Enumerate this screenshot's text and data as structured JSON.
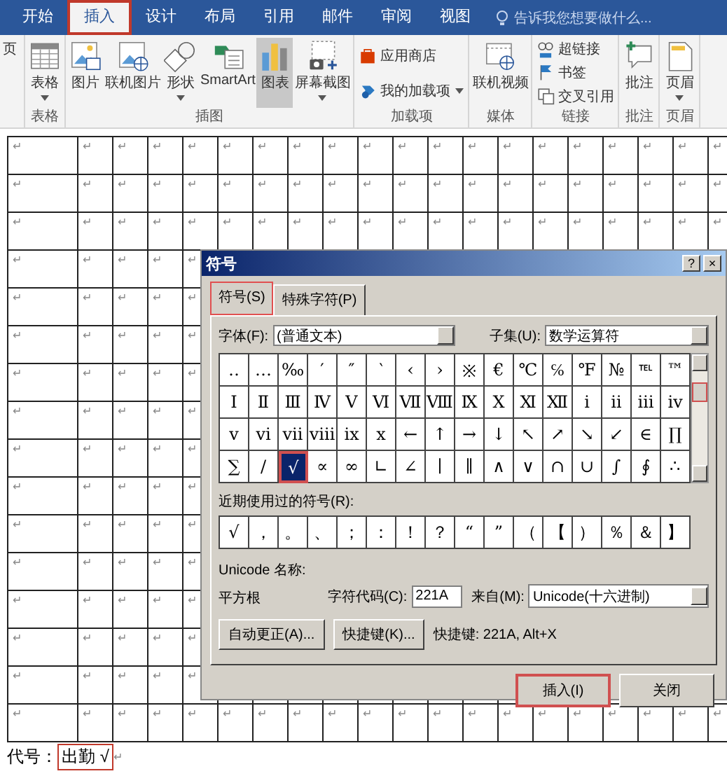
{
  "ribbon": {
    "tabs": [
      {
        "label": "开始",
        "selected": false,
        "highlighted": false
      },
      {
        "label": "插入",
        "selected": true,
        "highlighted": true
      },
      {
        "label": "设计",
        "selected": false,
        "highlighted": false
      },
      {
        "label": "布局",
        "selected": false,
        "highlighted": false
      },
      {
        "label": "引用",
        "selected": false,
        "highlighted": false
      },
      {
        "label": "邮件",
        "selected": false,
        "highlighted": false
      },
      {
        "label": "审阅",
        "selected": false,
        "highlighted": false
      },
      {
        "label": "视图",
        "selected": false,
        "highlighted": false
      }
    ],
    "tell_me": "告诉我您想要做什么...",
    "groups": [
      {
        "items": [
          {
            "label": "页",
            "kind": "large",
            "dropdown": false,
            "hovered": false
          }
        ]
      },
      {
        "label": "表格",
        "items": [
          {
            "label": "表格",
            "kind": "large",
            "dropdown": true,
            "hovered": false
          }
        ]
      },
      {
        "label": "插图",
        "items": [
          {
            "label": "图片",
            "kind": "large",
            "dropdown": false,
            "hovered": false
          },
          {
            "label": "联机图片",
            "kind": "large",
            "dropdown": false,
            "hovered": false
          },
          {
            "label": "形状",
            "kind": "large",
            "dropdown": true,
            "hovered": false
          },
          {
            "label": "SmartArt",
            "kind": "large",
            "dropdown": false,
            "hovered": false
          },
          {
            "label": "图表",
            "kind": "large",
            "dropdown": false,
            "hovered": true
          },
          {
            "label": "屏幕截图",
            "kind": "large",
            "dropdown": true,
            "hovered": false
          }
        ]
      },
      {
        "label": "加载项",
        "items": [
          {
            "label": "应用商店",
            "kind": "small",
            "dropdown": false,
            "hovered": false
          },
          {
            "label": "我的加载项",
            "kind": "small",
            "dropdown": true,
            "hovered": false
          }
        ]
      },
      {
        "label": "媒体",
        "items": [
          {
            "label": "联机视频",
            "kind": "large",
            "dropdown": false,
            "hovered": false
          }
        ]
      },
      {
        "label": "链接",
        "items": [
          {
            "label": "超链接",
            "kind": "small",
            "dropdown": false,
            "hovered": false
          },
          {
            "label": "书签",
            "kind": "small",
            "dropdown": false,
            "hovered": false
          },
          {
            "label": "交叉引用",
            "kind": "small",
            "dropdown": false,
            "hovered": false
          }
        ]
      },
      {
        "label": "批注",
        "items": [
          {
            "label": "批注",
            "kind": "large",
            "dropdown": false,
            "hovered": false
          }
        ]
      },
      {
        "label": "页眉",
        "items": [
          {
            "label": "页眉",
            "kind": "large",
            "dropdown": true,
            "hovered": false
          }
        ]
      }
    ]
  },
  "table": {
    "rows": [
      {
        "cells": [
          "↵",
          "↵",
          "↵",
          "↵",
          "↵",
          "↵",
          "↵",
          "↵",
          "↵",
          "↵",
          "↵",
          "↵",
          "↵",
          "↵",
          "↵",
          "↵",
          "↵",
          "↵",
          "↵",
          "↵"
        ]
      },
      {
        "cells": [
          "↵",
          "↵",
          "↵",
          "↵",
          "↵",
          "↵",
          "↵",
          "↵",
          "↵",
          "↵",
          "↵",
          "↵",
          "↵",
          "↵",
          "↵",
          "↵",
          "↵",
          "↵",
          "↵",
          "↵"
        ]
      },
      {
        "cells": [
          "↵",
          "↵",
          "↵",
          "↵",
          "↵",
          "↵",
          "↵",
          "↵",
          "↵",
          "↵",
          "↵",
          "↵",
          "↵",
          "↵",
          "↵",
          "↵",
          "↵",
          "↵",
          "↵",
          "↵"
        ]
      },
      {
        "cells": [
          "↵",
          "↵",
          "↵",
          "↵",
          "↵"
        ]
      },
      {
        "cells": [
          "↵",
          "↵",
          "↵",
          "↵",
          "↵"
        ]
      },
      {
        "cells": [
          "↵",
          "↵",
          "↵",
          "↵",
          "↵"
        ]
      },
      {
        "cells": [
          "↵",
          "↵",
          "↵",
          "↵",
          "↵"
        ]
      },
      {
        "cells": [
          "↵",
          "↵",
          "↵",
          "↵",
          "↵"
        ]
      },
      {
        "cells": [
          "↵",
          "↵",
          "↵",
          "↵",
          "↵"
        ]
      },
      {
        "cells": [
          "↵",
          "↵",
          "↵",
          "↵",
          "↵"
        ]
      },
      {
        "cells": [
          "↵",
          "↵",
          "↵",
          "↵",
          "↵"
        ]
      },
      {
        "cells": [
          "↵",
          "↵",
          "↵",
          "↵",
          "↵"
        ]
      },
      {
        "cells": [
          "↵",
          "↵",
          "↵",
          "↵",
          "↵"
        ]
      },
      {
        "cells": [
          "↵",
          "↵",
          "↵",
          "↵",
          "↵"
        ]
      },
      {
        "cells": [
          "↵",
          "↵",
          "↵",
          "↵",
          "↵"
        ]
      },
      {
        "cells": [
          "↵",
          "↵",
          "↵",
          "↵",
          "↵",
          "↵",
          "↵",
          "↵",
          "↵",
          "↵",
          "↵",
          "↵",
          "↵",
          "↵",
          "↵",
          "↵",
          "↵",
          "↵",
          "↵",
          "↵"
        ]
      }
    ]
  },
  "footer": {
    "label": "代号：",
    "value": "出勤 √",
    "highlighted": true,
    "mark": "↵"
  },
  "dialog": {
    "title": "符号",
    "help": "?",
    "close": "×",
    "tabs": [
      {
        "label": "符号(S)",
        "selected": true,
        "highlighted": true
      },
      {
        "label": "特殊字符(P)",
        "selected": false,
        "highlighted": false
      }
    ],
    "font_label": "字体(F):",
    "font_value": "(普通文本)",
    "subset_label": "子集(U):",
    "subset_value": "数学运算符",
    "symbols": [
      {
        "char": "‥",
        "selected": false
      },
      {
        "char": "…",
        "selected": false
      },
      {
        "char": "‰",
        "selected": false
      },
      {
        "char": "′",
        "selected": false
      },
      {
        "char": "″",
        "selected": false
      },
      {
        "char": "‵",
        "selected": false
      },
      {
        "char": "‹",
        "selected": false
      },
      {
        "char": "›",
        "selected": false
      },
      {
        "char": "※",
        "selected": false
      },
      {
        "char": "€",
        "selected": false
      },
      {
        "char": "℃",
        "selected": false
      },
      {
        "char": "℅",
        "selected": false
      },
      {
        "char": "℉",
        "selected": false
      },
      {
        "char": "№",
        "selected": false
      },
      {
        "char": "℡",
        "selected": false
      },
      {
        "char": "™",
        "selected": false
      },
      {
        "char": "Ⅰ",
        "selected": false
      },
      {
        "char": "Ⅱ",
        "selected": false
      },
      {
        "char": "Ⅲ",
        "selected": false
      },
      {
        "char": "Ⅳ",
        "selected": false
      },
      {
        "char": "Ⅴ",
        "selected": false
      },
      {
        "char": "Ⅵ",
        "selected": false
      },
      {
        "char": "Ⅶ",
        "selected": false
      },
      {
        "char": "Ⅷ",
        "selected": false
      },
      {
        "char": "Ⅸ",
        "selected": false
      },
      {
        "char": "Ⅹ",
        "selected": false
      },
      {
        "char": "Ⅺ",
        "selected": false
      },
      {
        "char": "Ⅻ",
        "selected": false
      },
      {
        "char": "ⅰ",
        "selected": false
      },
      {
        "char": "ⅱ",
        "selected": false
      },
      {
        "char": "ⅲ",
        "selected": false
      },
      {
        "char": "ⅳ",
        "selected": false
      },
      {
        "char": "ⅴ",
        "selected": false
      },
      {
        "char": "ⅵ",
        "selected": false
      },
      {
        "char": "ⅶ",
        "selected": false
      },
      {
        "char": "ⅷ",
        "selected": false
      },
      {
        "char": "ⅸ",
        "selected": false
      },
      {
        "char": "ⅹ",
        "selected": false
      },
      {
        "char": "←",
        "selected": false
      },
      {
        "char": "↑",
        "selected": false
      },
      {
        "char": "→",
        "selected": false
      },
      {
        "char": "↓",
        "selected": false
      },
      {
        "char": "↖",
        "selected": false
      },
      {
        "char": "↗",
        "selected": false
      },
      {
        "char": "↘",
        "selected": false
      },
      {
        "char": "↙",
        "selected": false
      },
      {
        "char": "∈",
        "selected": false
      },
      {
        "char": "∏",
        "selected": false
      },
      {
        "char": "∑",
        "selected": false
      },
      {
        "char": "∕",
        "selected": false
      },
      {
        "char": "√",
        "selected": true
      },
      {
        "char": "∝",
        "selected": false
      },
      {
        "char": "∞",
        "selected": false
      },
      {
        "char": "∟",
        "selected": false
      },
      {
        "char": "∠",
        "selected": false
      },
      {
        "char": "∣",
        "selected": false
      },
      {
        "char": "∥",
        "selected": false
      },
      {
        "char": "∧",
        "selected": false
      },
      {
        "char": "∨",
        "selected": false
      },
      {
        "char": "∩",
        "selected": false
      },
      {
        "char": "∪",
        "selected": false
      },
      {
        "char": "∫",
        "selected": false
      },
      {
        "char": "∮",
        "selected": false
      },
      {
        "char": "∴",
        "selected": false
      }
    ],
    "scrollbar": {
      "highlighted": true
    },
    "recent_label": "近期使用过的符号(R):",
    "recent": [
      "√",
      "，",
      "。",
      "、",
      "；",
      "：",
      "！",
      "？",
      "“",
      "”",
      "（",
      "【",
      "）",
      "％",
      "＆",
      "】"
    ],
    "unicode_name_label": "Unicode 名称:",
    "unicode_name": "平方根",
    "code_label": "字符代码(C):",
    "code_value": "221A",
    "from_label": "来自(M):",
    "from_value": "Unicode(十六进制)",
    "autocorrect_button": "自动更正(A)...",
    "shortcut_button": "快捷键(K)...",
    "shortcut_text": "快捷键: 221A, Alt+X",
    "insert_button": {
      "label": "插入(I)",
      "highlighted": true
    },
    "close_button": "关闭"
  }
}
